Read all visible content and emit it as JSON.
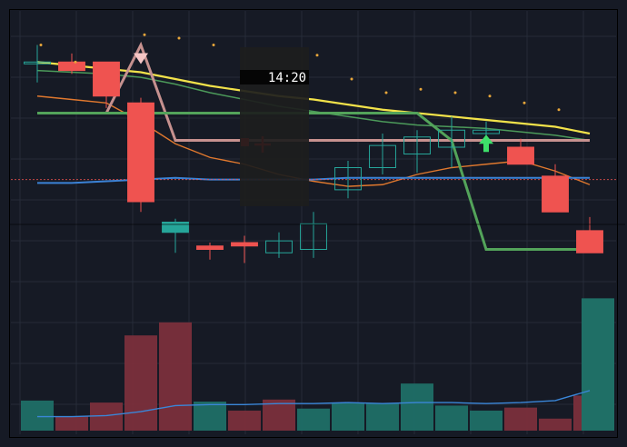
{
  "crosshair": {
    "time_label": "14:20"
  },
  "colors": {
    "background": "#161a25",
    "grid": "#262b38",
    "bull": "#26a69a",
    "bear": "#ef5350",
    "bull_volume": "#1f6f66",
    "bear_volume": "#7a2f3b",
    "ma_yellow": "#f2e24a",
    "ma_green": "#4c9a5a",
    "ma_orange": "#e0782e",
    "signal_pink": "#c6918f",
    "signal_green": "#53a35a",
    "blue_line": "#3b82d6",
    "volume_ma": "#3a86d8",
    "dots": "#e8a63a",
    "arrow_up": "#3ee06a",
    "arrow_down": "#f6c6c6",
    "red_marker": "#ff2020"
  },
  "chart_data": [
    {
      "type": "candlestick",
      "panel": "price",
      "categories": [
        1,
        2,
        3,
        4,
        5,
        6,
        7,
        8,
        9,
        10,
        11,
        12,
        13,
        14,
        15,
        16,
        17
      ],
      "candles": [
        {
          "o": 170,
          "h": 180,
          "l": 158,
          "c": 170,
          "dir": "bull"
        },
        {
          "o": 165,
          "h": 175,
          "l": 163,
          "c": 170,
          "dir": "bear"
        },
        {
          "o": 170,
          "h": 170,
          "l": 143,
          "c": 150,
          "dir": "bear"
        },
        {
          "o": 146,
          "h": 149,
          "l": 82,
          "c": 88,
          "dir": "bear"
        },
        {
          "o": 70,
          "h": 78,
          "l": 58,
          "c": 76,
          "dir": "bull"
        },
        {
          "o": 62,
          "h": 64,
          "l": 54,
          "c": 60,
          "dir": "bear"
        },
        {
          "o": 64,
          "h": 68,
          "l": 52,
          "c": 62,
          "dir": "bear"
        },
        {
          "o": 58,
          "h": 70,
          "l": 55,
          "c": 65,
          "dir": "bull"
        },
        {
          "o": 60,
          "h": 82,
          "l": 55,
          "c": 75,
          "dir": "bull"
        },
        {
          "o": 95,
          "h": 112,
          "l": 90,
          "c": 108,
          "dir": "bull"
        },
        {
          "o": 108,
          "h": 128,
          "l": 104,
          "c": 121,
          "dir": "bull"
        },
        {
          "o": 116,
          "h": 130,
          "l": 105,
          "c": 126,
          "dir": "bull"
        },
        {
          "o": 120,
          "h": 138,
          "l": 108,
          "c": 130,
          "dir": "bull"
        },
        {
          "o": 128,
          "h": 135,
          "l": 126,
          "c": 130,
          "dir": "bull"
        },
        {
          "o": 120,
          "h": 125,
          "l": 112,
          "c": 110,
          "dir": "bear"
        },
        {
          "o": 103,
          "h": 110,
          "l": 88,
          "c": 82,
          "dir": "bear"
        },
        {
          "o": 71,
          "h": 79,
          "l": 60,
          "c": 58,
          "dir": "bear"
        }
      ],
      "ylim": [
        40,
        200
      ]
    },
    {
      "type": "bar",
      "panel": "volume",
      "categories": [
        1,
        2,
        3,
        4,
        5,
        6,
        7,
        8,
        9,
        10,
        11,
        12,
        13,
        14,
        15,
        16,
        17
      ],
      "values": [
        30,
        14,
        28,
        95,
        108,
        29,
        20,
        31,
        22,
        28,
        27,
        47,
        25,
        20,
        23,
        12,
        35
      ],
      "directions": [
        "bull",
        "bear",
        "bear",
        "bear",
        "bear",
        "bull",
        "bear",
        "bear",
        "bull",
        "bull",
        "bull",
        "bull",
        "bull",
        "bull",
        "bear",
        "bear",
        "bear"
      ],
      "last_bar": {
        "value": 132,
        "dir": "bull"
      },
      "ma": [
        14,
        14,
        15,
        19,
        25,
        26,
        26,
        27,
        27,
        28,
        27,
        28,
        28,
        27,
        28,
        30,
        40
      ],
      "ylim": [
        0,
        145
      ]
    }
  ]
}
